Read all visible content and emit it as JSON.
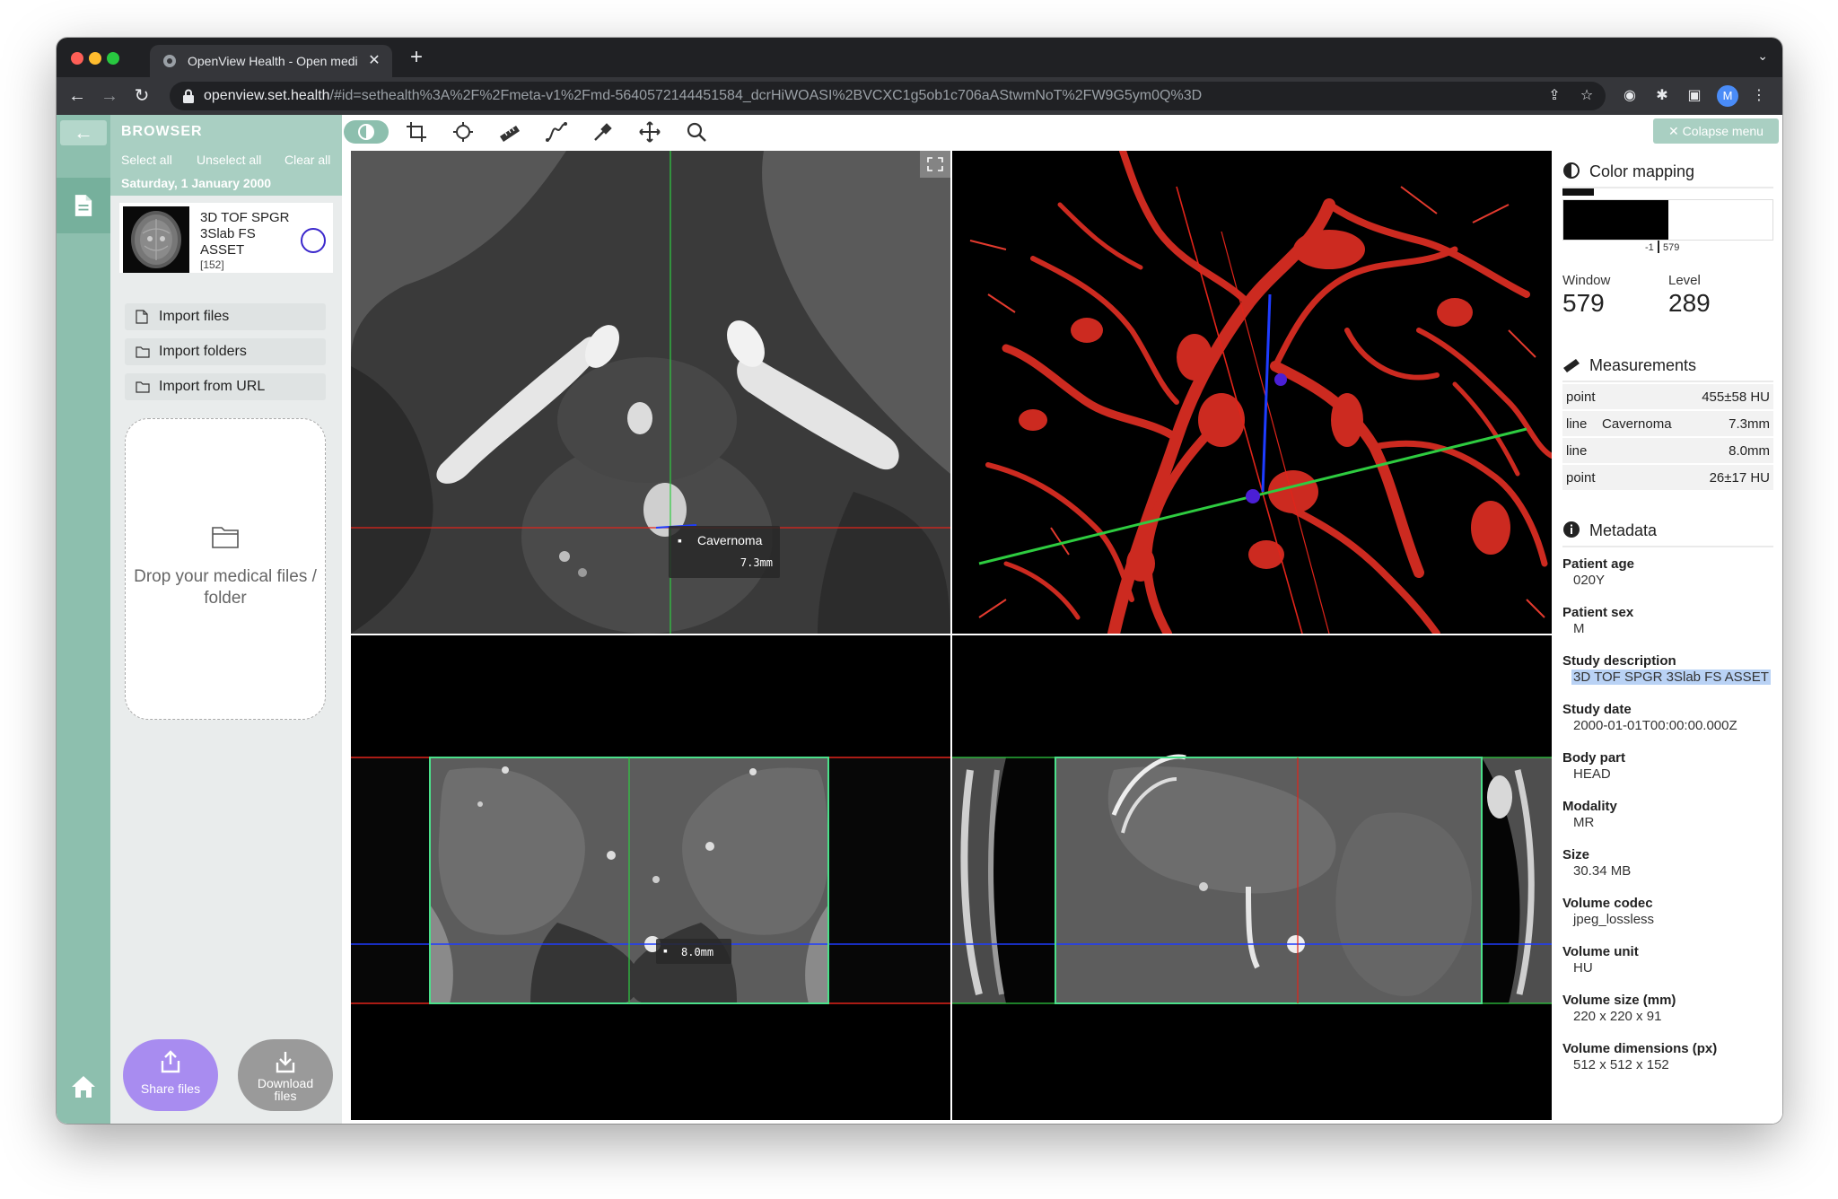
{
  "browser": {
    "tab_title": "OpenView Health - Open medic",
    "url_host": "openview.set.health",
    "url_rest": "/#id=sethealth%3A%2F%2Fmeta-v1%2Fmd-5640572144451584_dcrHiWOASI%2BVCXC1g5ob1c706aAStwmNoT%2FW9G5ym0Q%3D",
    "profile_initial": "M"
  },
  "sidebar": {
    "title": "BROWSER",
    "select_all": "Select all",
    "unselect_all": "Unselect all",
    "clear_all": "Clear all",
    "date": "Saturday, 1 January 2000",
    "series": {
      "name": "3D TOF SPGR 3Slab FS ASSET",
      "count": "[152]"
    },
    "import_files": "Import files",
    "import_folders": "Import folders",
    "import_url": "Import from URL",
    "drop_text": "Drop your medical files / folder",
    "share_label": "Share files",
    "download_label": "Download files"
  },
  "toolbar": {
    "collapse_label": "✕ Colapse menu",
    "tools": [
      "contrast-tool",
      "crop-tool",
      "crosshair-tool",
      "ruler-tool",
      "curve-tool",
      "pipette-tool",
      "move-tool",
      "zoom-tool"
    ]
  },
  "viewports": {
    "axial_annotation_label": "Cavernoma",
    "axial_annotation_value": "7.3mm",
    "coronal_annotation_value": "8.0mm"
  },
  "colors": {
    "accent": "#8dbfae",
    "accent_light": "#a9cfc2",
    "vessel_red": "#d42a20",
    "crosshair_green": "#2ecc40",
    "crosshair_blue": "#1e3cff",
    "crosshair_red": "#e0241a"
  },
  "right_panel": {
    "color_mapping_title": "Color mapping",
    "histogram_min": "-1",
    "histogram_max": "579",
    "window_label": "Window",
    "window_value": "579",
    "level_label": "Level",
    "level_value": "289",
    "measurements_title": "Measurements",
    "measurements": [
      {
        "type": "point",
        "desc": "",
        "value": "455±58 HU"
      },
      {
        "type": "line",
        "desc": "Cavernoma",
        "value": "7.3mm"
      },
      {
        "type": "line",
        "desc": "",
        "value": "8.0mm"
      },
      {
        "type": "point",
        "desc": "",
        "value": "26±17 HU"
      }
    ],
    "metadata_title": "Metadata",
    "metadata": [
      {
        "key": "Patient age",
        "value": "020Y"
      },
      {
        "key": "Patient sex",
        "value": "M"
      },
      {
        "key": "Study description",
        "value": "3D TOF SPGR 3Slab FS ASSET"
      },
      {
        "key": "Study date",
        "value": "2000-01-01T00:00:00.000Z"
      },
      {
        "key": "Body part",
        "value": "HEAD"
      },
      {
        "key": "Modality",
        "value": "MR"
      },
      {
        "key": "Size",
        "value": "30.34 MB"
      },
      {
        "key": "Volume codec",
        "value": "jpeg_lossless"
      },
      {
        "key": "Volume unit",
        "value": "HU"
      },
      {
        "key": "Volume size (mm)",
        "value": "220 x 220 x 91"
      },
      {
        "key": "Volume dimensions (px)",
        "value": "512 x 512 x 152"
      }
    ]
  }
}
